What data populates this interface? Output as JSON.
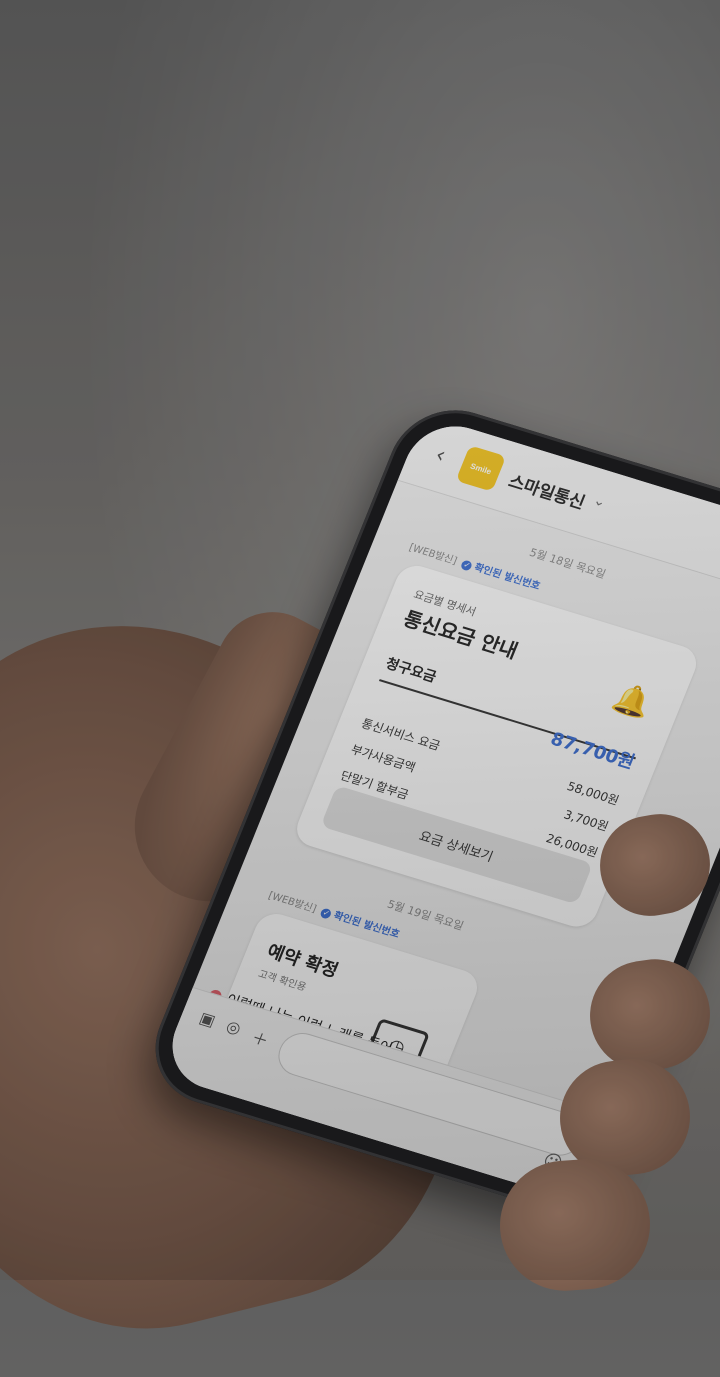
{
  "app": {
    "sender_name": "스마일통신",
    "logo_text": "Smile",
    "back_icon": "back-icon",
    "chevron_icon": "chevron-down-icon"
  },
  "messages": [
    {
      "date": "5월 18일 목요일",
      "tag_prefix": "[WEB발신]",
      "tag_verified": "확인된 발신번호",
      "card": {
        "subtitle": "요금별 명세서",
        "title": "통신요금 안내",
        "icon": "bell-icon",
        "section": "청구요금",
        "total_amount": "87,700원",
        "rows": [
          {
            "label": "통신서비스 요금",
            "amount": "58,000원"
          },
          {
            "label": "부가사용금액",
            "amount": "3,700원"
          },
          {
            "label": "단말기 할부금",
            "amount": "26,000원"
          }
        ],
        "button_label": "요금 상세보기"
      }
    },
    {
      "date": "5월 19일 목요일",
      "tag_prefix": "[WEB발신]",
      "tag_verified": "확인된 발신번호",
      "card": {
        "title": "예약 확정",
        "subtitle": "고객 확인용",
        "icon": "calendar-clock-icon"
      }
    }
  ],
  "notice": {
    "text": "이럴때 나는 이런 노래를 들어"
  },
  "input_bar": {
    "icons": [
      "gallery-icon",
      "camera-icon",
      "plus-icon"
    ],
    "emoji_icon": "emoji-icon"
  },
  "colors": {
    "accent": "#3b6fd4",
    "logo": "#f2c21b",
    "background": "#6e6c6a"
  }
}
